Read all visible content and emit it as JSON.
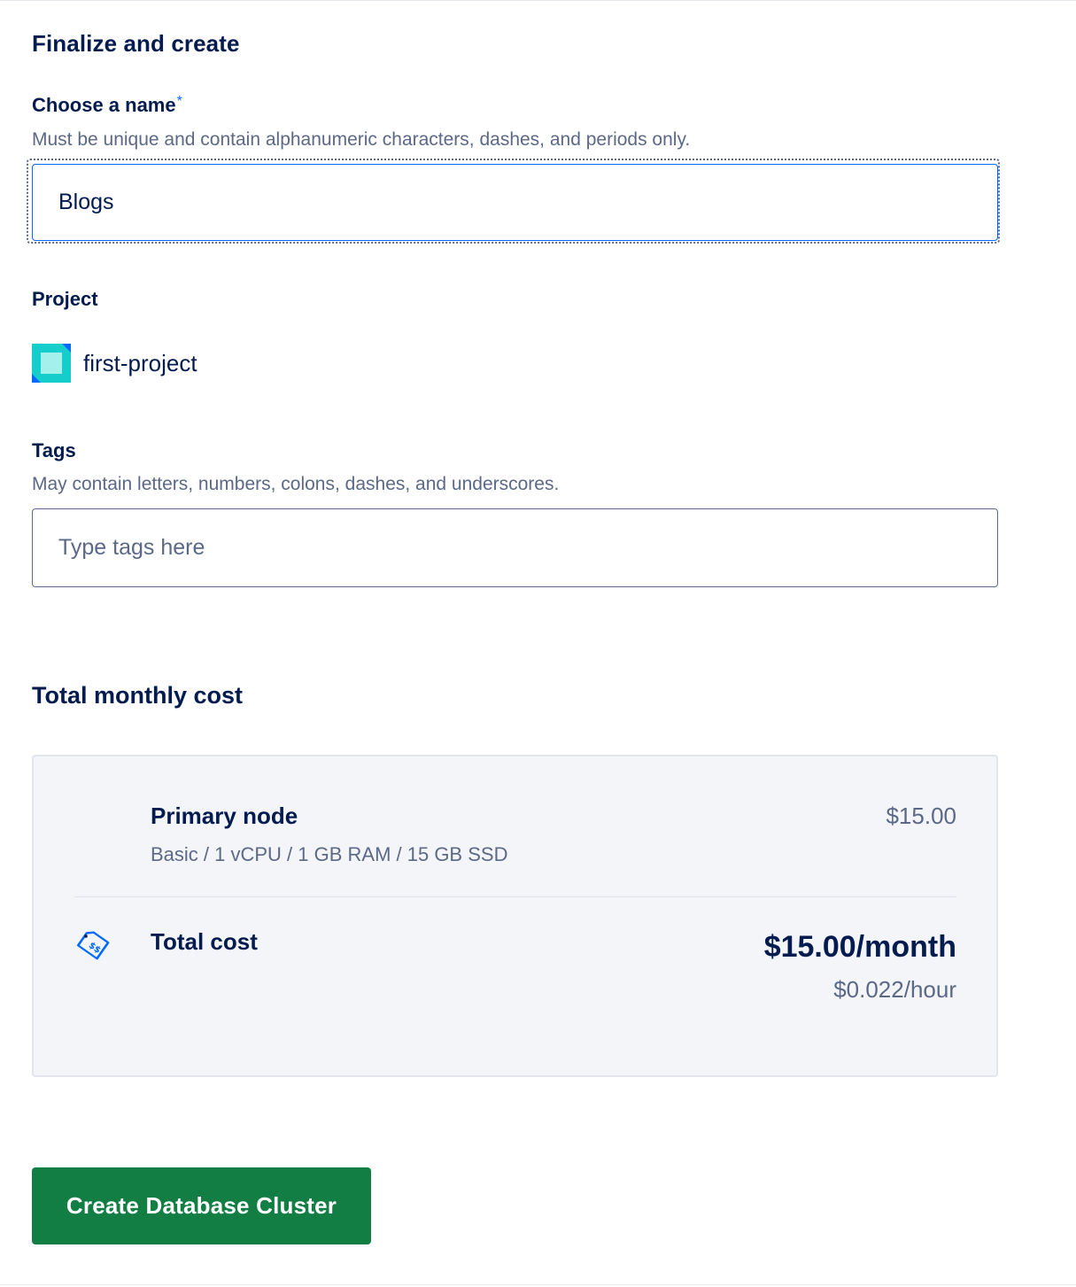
{
  "form": {
    "section_title": "Finalize and create",
    "name": {
      "label": "Choose a name",
      "required_mark": "*",
      "help": "Must be unique and contain alphanumeric characters, dashes, and periods only.",
      "value": "Blogs"
    },
    "project": {
      "label": "Project",
      "selected": "first-project",
      "icon": "project-square-icon"
    },
    "tags": {
      "label": "Tags",
      "help": "May contain letters, numbers, colons, dashes, and underscores.",
      "value": "",
      "placeholder": "Type tags here"
    }
  },
  "cost": {
    "title": "Total monthly cost",
    "line_items": [
      {
        "name": "Primary node",
        "spec": "Basic / 1 vCPU / 1 GB RAM / 15 GB SSD",
        "price": "$15.00"
      }
    ],
    "total_label": "Total cost",
    "total_monthly": "$15.00/month",
    "total_hourly": "$0.022/hour",
    "total_icon": "price-tag-icon"
  },
  "actions": {
    "create_label": "Create Database Cluster"
  },
  "colors": {
    "text_primary": "#031b4e",
    "text_secondary": "#5b6987",
    "focus_blue": "#0069ff",
    "create_green": "#137e44",
    "cost_panel_bg": "#f3f5f9"
  }
}
